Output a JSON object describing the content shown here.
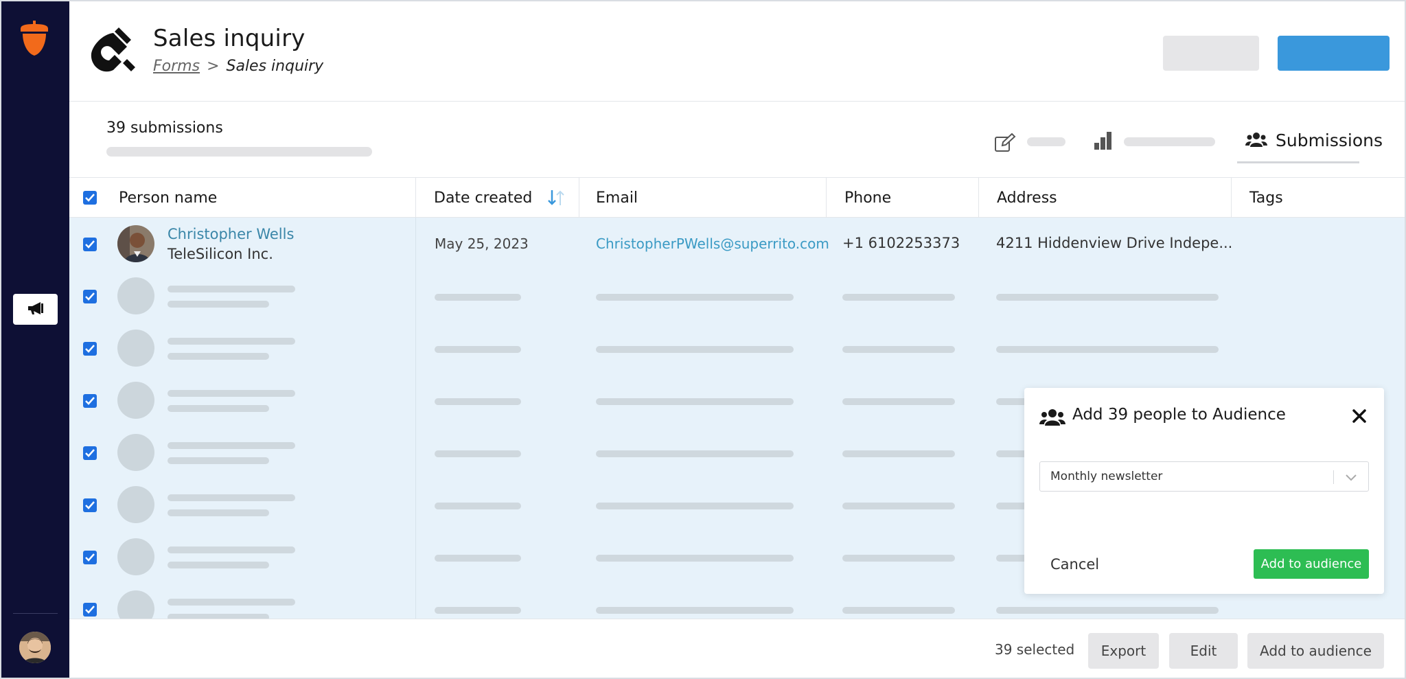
{
  "colors": {
    "sidebar_bg": "#0e1035",
    "brand_orange": "#f26a1b",
    "primary_blue": "#3a98dc",
    "checkbox_blue": "#1e6fe0",
    "row_highlight": "#e7f2fa",
    "success_green": "#2dbd53"
  },
  "sidebar": {
    "logo_icon": "acorn-icon",
    "nav_icon": "megaphone-icon"
  },
  "header": {
    "icon": "magnet-icon",
    "title": "Sales inquiry",
    "breadcrumb": {
      "parent": "Forms",
      "separator": ">",
      "current": "Sales inquiry"
    }
  },
  "subheader": {
    "count_label": "39 submissions",
    "edit_icon": "edit-icon",
    "chart_icon": "bar-chart-icon",
    "active_tab_icon": "people-icon",
    "active_tab_label": "Submissions"
  },
  "table": {
    "columns": {
      "name": "Person name",
      "date": "Date created",
      "email": "Email",
      "phone": "Phone",
      "address": "Address",
      "tags": "Tags"
    },
    "first_row": {
      "name": "Christopher Wells",
      "company": "TeleSilicon Inc.",
      "date": "May 25, 2023",
      "email": "ChristopherPWells@superrito.com",
      "phone": "+1 6102253373",
      "address": "4211 Hiddenview Drive Indepe..."
    }
  },
  "footer": {
    "selected_label": "39 selected",
    "export_label": "Export",
    "edit_label": "Edit",
    "add_label": "Add to audience"
  },
  "modal": {
    "title": "Add 39 people to Audience",
    "select_value": "Monthly newsletter",
    "cancel_label": "Cancel",
    "submit_label": "Add to audience"
  }
}
